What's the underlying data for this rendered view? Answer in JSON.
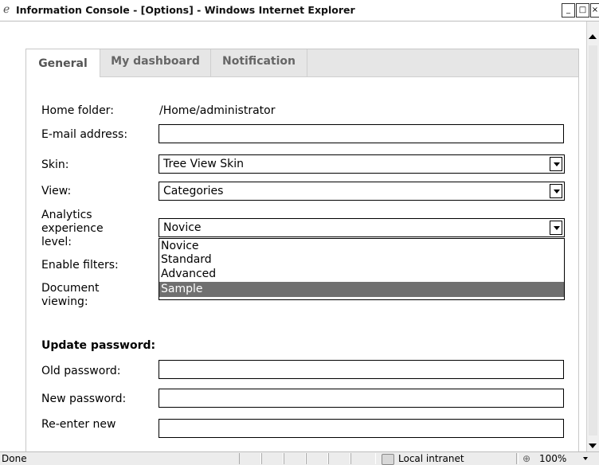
{
  "window": {
    "title": "Information Console - [Options] - Windows Internet Explorer",
    "minimize": "_",
    "maximize": "□",
    "close": "×"
  },
  "tabs": [
    {
      "label": "General",
      "active": true
    },
    {
      "label": "My dashboard",
      "active": false
    },
    {
      "label": "Notification",
      "active": false
    }
  ],
  "form": {
    "home_folder_label": "Home folder:",
    "home_folder_value": "/Home/administrator",
    "email_label": "E-mail address:",
    "email_value": "",
    "skin_label": "Skin:",
    "skin_value": "Tree View Skin",
    "view_label": "View:",
    "view_value": "Categories",
    "analytics_label_1": "Analytics",
    "analytics_label_2": "experience",
    "analytics_label_3": "level:",
    "analytics_value": "Novice",
    "analytics_options": [
      "Novice",
      "Standard",
      "Advanced",
      "Sample"
    ],
    "analytics_highlighted": "Sample",
    "filters_label": "Enable filters:",
    "doc_label_1": "Document",
    "doc_label_2": "viewing:"
  },
  "password": {
    "heading": "Update password:",
    "old_label": "Old password:",
    "new_label": "New password:",
    "reenter_label": "Re-enter new"
  },
  "status": {
    "text": "Done",
    "zone": "Local intranet",
    "zoom": "100%"
  },
  "colors": {
    "highlight": "#707070",
    "tabstrip": "#e6e6e6"
  }
}
